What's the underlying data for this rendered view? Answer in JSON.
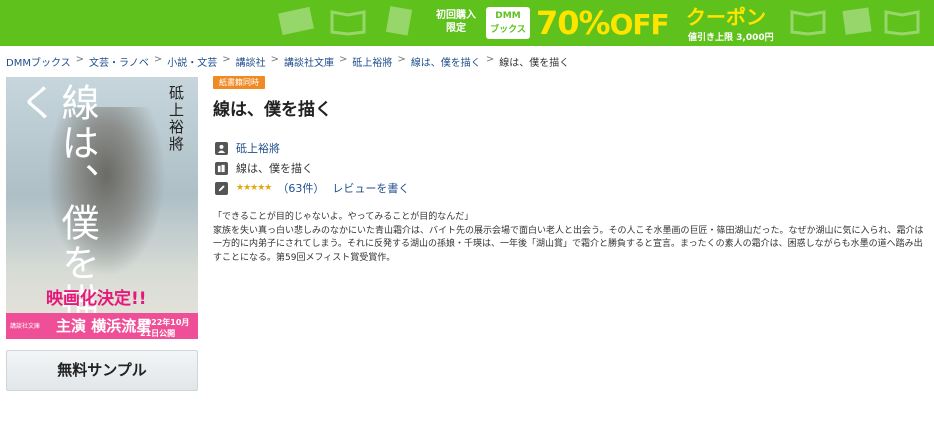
{
  "banner": {
    "first_purchase": "初回購入\n限定",
    "logo": "DMM\nブックス",
    "percent": "70%",
    "off": "OFF",
    "coupon": "クーポン",
    "limit": "値引き上限 3,000円",
    "color": "#5fc11c"
  },
  "breadcrumb": [
    "DMMブックス",
    "文芸・ラノベ",
    "小説・文芸",
    "講談社",
    "講談社文庫",
    "砥上裕將",
    "線は、僕を描く",
    "線は、僕を描く"
  ],
  "cover": {
    "title": "線は、僕を描く",
    "author": "砥上裕將",
    "movie": "映画化決定!!",
    "band_small": "講談社文庫",
    "band_star": "主演 横浜流星",
    "band_date": "2022年10月21日公開"
  },
  "sample_button": "無料サンプル",
  "badge": "紙書籍同時",
  "book": {
    "title": "線は、僕を描く",
    "author": "砥上裕將",
    "series": "線は、僕を描く",
    "rating_stars": "★★★★★",
    "review_count": "（63件）",
    "write_review": "レビューを書く"
  },
  "description": "「できることが目的じゃないよ。やってみることが目的なんだ」\n家族を失い真っ白い悲しみのなかにいた青山霜介は、バイト先の展示会場で面白い老人と出会う。その人こそ水墨画の巨匠・篠田湖山だった。なぜか湖山に気に入られ、霜介は一方的に内弟子にされてしまう。それに反発する湖山の孫娘・千瑛は、一年後「湖山賞」で霜介と勝負すると宣言。まったくの素人の霜介は、困惑しながらも水墨の道へ踏み出すことになる。第59回メフィスト賞受賞作。",
  "colors": {
    "accent_badge": "#f08a24",
    "link": "#1f4e8c",
    "star": "#e4a710"
  }
}
